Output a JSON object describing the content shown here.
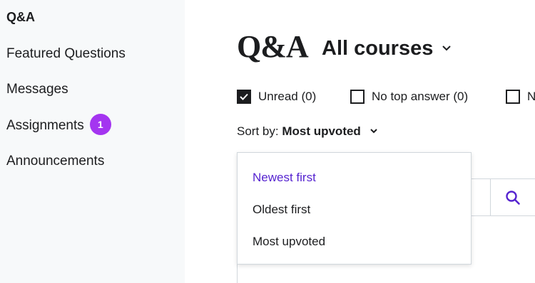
{
  "sidebar": {
    "title": "Q&A",
    "items": [
      {
        "label": "Featured Questions"
      },
      {
        "label": "Messages"
      },
      {
        "label": "Assignments",
        "badge": "1"
      },
      {
        "label": "Announcements"
      }
    ]
  },
  "main": {
    "page_title": "Q&A",
    "course_filter": "All courses",
    "filters": [
      {
        "label": "Unread (0)",
        "checked": true
      },
      {
        "label": "No top answer (0)",
        "checked": false
      },
      {
        "label": "N",
        "checked": false
      }
    ],
    "sort": {
      "prefix": "Sort by:",
      "value": "Most upvoted"
    },
    "search_icon": "search-icon"
  },
  "sort_dropdown": {
    "options": [
      {
        "label": "Newest first",
        "highlighted": true
      },
      {
        "label": "Oldest first",
        "highlighted": false
      },
      {
        "label": "Most upvoted",
        "highlighted": false
      }
    ]
  },
  "colors": {
    "sidebar_bg": "#f7f9fa",
    "badge": "#a435f0",
    "accent": "#5624d0",
    "text": "#1c1d1f",
    "border": "#d1d7dc"
  }
}
